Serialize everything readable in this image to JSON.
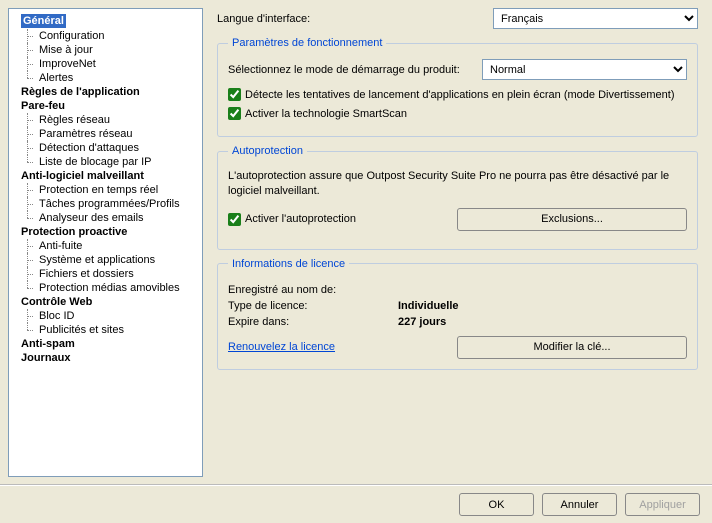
{
  "sidebar": {
    "categories": [
      {
        "label": "Général",
        "selected": true,
        "items": [
          "Configuration",
          "Mise à jour",
          "ImproveNet",
          "Alertes"
        ]
      },
      {
        "label": "Règles de l'application",
        "items": []
      },
      {
        "label": "Pare-feu",
        "items": [
          "Règles réseau",
          "Paramètres réseau",
          "Détection d'attaques",
          "Liste de blocage par IP"
        ]
      },
      {
        "label": "Anti-logiciel malveillant",
        "items": [
          "Protection en temps réel",
          "Tâches programmées/Profils",
          "Analyseur des emails"
        ]
      },
      {
        "label": "Protection proactive",
        "items": [
          "Anti-fuite",
          "Système et applications",
          "Fichiers et dossiers",
          "Protection médias amovibles"
        ]
      },
      {
        "label": "Contrôle Web",
        "items": [
          "Bloc ID",
          "Publicités et sites"
        ]
      },
      {
        "label": "Anti-spam",
        "items": []
      },
      {
        "label": "Journaux",
        "items": []
      }
    ]
  },
  "main": {
    "language_label": "Langue d'interface:",
    "language_value": "Français",
    "group_operation_title": "Paramètres de fonctionnement",
    "startup_mode_label": "Sélectionnez le mode de démarrage du produit:",
    "startup_mode_value": "Normal",
    "chk_fullscreen": "Détecte les tentatives de lancement d'applications en plein écran (mode Divertissement)",
    "chk_smartscan": "Activer la technologie SmartScan",
    "group_autoprotect_title": "Autoprotection",
    "autoprotect_desc": "L'autoprotection assure que Outpost Security Suite Pro ne pourra pas être désactivé par le logiciel malveillant.",
    "chk_autoprotect": "Activer l'autoprotection",
    "btn_exclusions": "Exclusions...",
    "group_license_title": "Informations de licence",
    "registered_label": "Enregistré au nom de:",
    "registered_value": "",
    "license_type_label": "Type de licence:",
    "license_type_value": "Individuelle",
    "expires_label": "Expire dans:",
    "expires_value": "227 jours",
    "link_renew": "Renouvelez la licence",
    "btn_change_key": "Modifier la clé..."
  },
  "footer": {
    "ok": "OK",
    "cancel": "Annuler",
    "apply": "Appliquer"
  }
}
